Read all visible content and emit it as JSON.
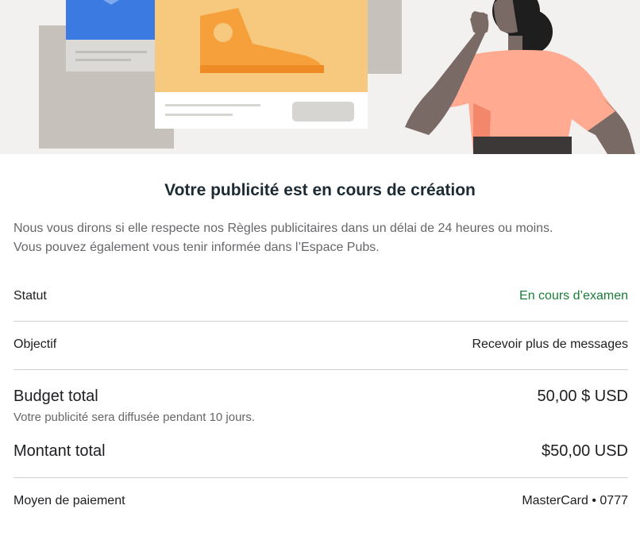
{
  "title": "Votre publicité est en cours de création",
  "description": {
    "line1": "Nous vous dirons si elle respecte nos Règles publicitaires dans un délai de 24 heures ou moins.",
    "line2": "Vous pouvez également vous tenir informée dans l’Espace Pubs."
  },
  "summary": {
    "status": {
      "label": "Statut",
      "value": "En cours d’examen"
    },
    "objective": {
      "label": "Objectif",
      "value": "Recevoir plus de messages"
    },
    "budget": {
      "label": "Budget total",
      "value": "50,00 $ USD",
      "note": "Votre publicité sera diffusée pendant 10 jours."
    },
    "total": {
      "label": "Montant total",
      "value": "$50,00 USD"
    },
    "payment": {
      "label": "Moyen de paiement",
      "value": "MasterCard • 0777"
    }
  },
  "colors": {
    "banner_bg": "#f2f1ef",
    "status_green": "#1b7d3a",
    "card_yellow": "#f7c97e",
    "shoe_orange": "#f5a03a",
    "blue_card": "#3b7ae0",
    "skin_dark": "#7a6a66",
    "shirt_pink": "#ffaa91"
  },
  "illustration": {
    "icons": [
      "sneaker-icon",
      "person-illustration"
    ]
  }
}
